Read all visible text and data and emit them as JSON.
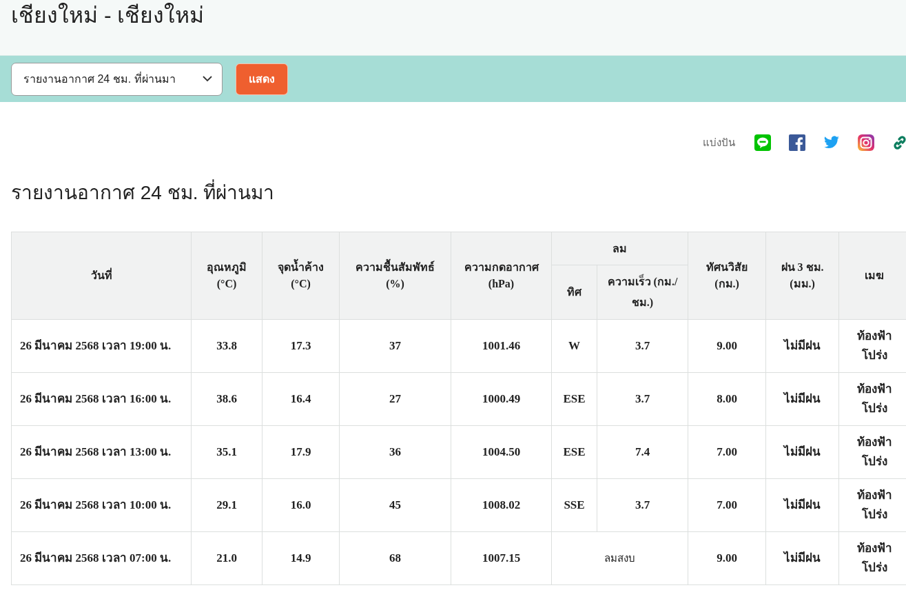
{
  "page_title": "เชียงใหม่ - เชียงใหม่",
  "report_select": {
    "value": "รายงานอากาศ 24 ชม. ที่ผ่านมา"
  },
  "show_button": "แสดง",
  "share": {
    "label": "แบ่งปัน",
    "icons": [
      {
        "kind": "line"
      },
      {
        "kind": "facebook"
      },
      {
        "kind": "twitter"
      },
      {
        "kind": "instagram"
      },
      {
        "kind": "link"
      }
    ]
  },
  "section_title": "รายงานอากาศ 24 ชม. ที่ผ่านมา",
  "table": {
    "columns": {
      "date": "วันที่",
      "temp": "อุณหภูมิ (°C)",
      "dew": "จุดน้ำค้าง (°C)",
      "humidity": "ความชื้นสัมพัทธ์ (%)",
      "pressure": "ความกดอากาศ (hPa)",
      "wind": "ลม",
      "wind_dir": "ทิศ",
      "wind_speed": "ความเร็ว (กม./ชม.)",
      "visibility": "ทัศนวิสัย (กม.)",
      "rain": "ฝน 3 ชม. (มม.)",
      "cloud": "เมฆ"
    },
    "rows": [
      {
        "kind": "wind",
        "date": "26 มีนาคม 2568 เวลา 19:00 น.",
        "temp": "33.8",
        "dew": "17.3",
        "humidity": "37",
        "pressure": "1001.46",
        "wind_dir": "W",
        "wind_speed": "3.7",
        "visibility": "9.00",
        "rain": "ไม่มีฝน",
        "cloud": "ท้องฟ้า โปร่ง"
      },
      {
        "kind": "wind",
        "date": "26 มีนาคม 2568 เวลา 16:00 น.",
        "temp": "38.6",
        "dew": "16.4",
        "humidity": "27",
        "pressure": "1000.49",
        "wind_dir": "ESE",
        "wind_speed": "3.7",
        "visibility": "8.00",
        "rain": "ไม่มีฝน",
        "cloud": "ท้องฟ้า โปร่ง"
      },
      {
        "kind": "wind",
        "date": "26 มีนาคม 2568 เวลา 13:00 น.",
        "temp": "35.1",
        "dew": "17.9",
        "humidity": "36",
        "pressure": "1004.50",
        "wind_dir": "ESE",
        "wind_speed": "7.4",
        "visibility": "7.00",
        "rain": "ไม่มีฝน",
        "cloud": "ท้องฟ้า โปร่ง"
      },
      {
        "kind": "wind",
        "date": "26 มีนาคม 2568 เวลา 10:00 น.",
        "temp": "29.1",
        "dew": "16.0",
        "humidity": "45",
        "pressure": "1008.02",
        "wind_dir": "SSE",
        "wind_speed": "3.7",
        "visibility": "7.00",
        "rain": "ไม่มีฝน",
        "cloud": "ท้องฟ้า โปร่ง"
      },
      {
        "kind": "calm",
        "date": "26 มีนาคม 2568 เวลา 07:00 น.",
        "temp": "21.0",
        "dew": "14.9",
        "humidity": "68",
        "pressure": "1007.15",
        "wind_text": "ลมสงบ",
        "visibility": "9.00",
        "rain": "ไม่มีฝน",
        "cloud": "ท้องฟ้า โปร่ง"
      }
    ]
  }
}
